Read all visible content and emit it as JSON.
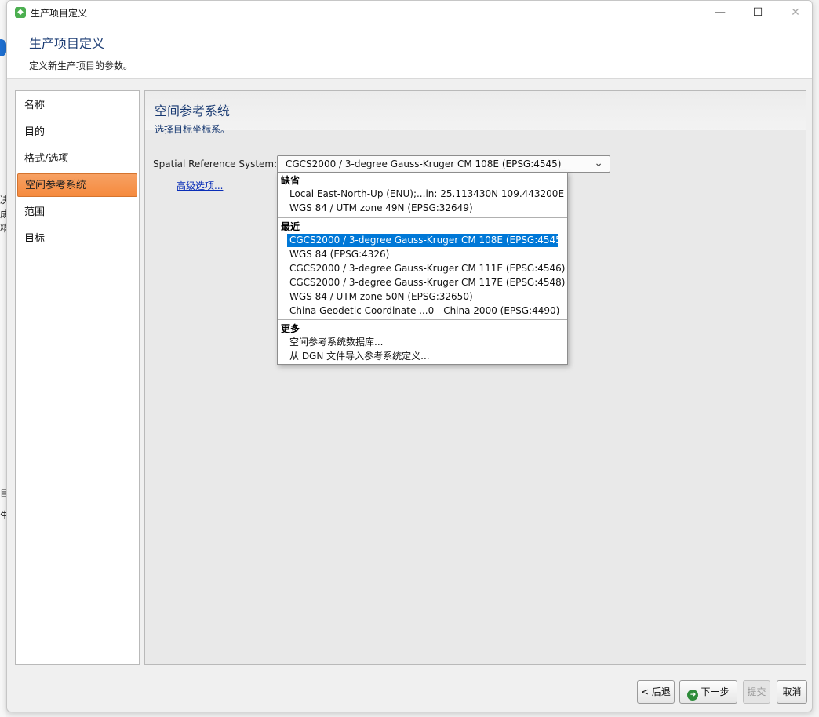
{
  "window": {
    "title": "生产项目定义",
    "header_title": "生产项目定义",
    "header_subtitle": "定义新生产项目的参数。"
  },
  "background_window": {
    "fragments": [
      "合",
      "决",
      "成",
      "精",
      "目",
      "生"
    ]
  },
  "nav": {
    "items": [
      {
        "label": "名称"
      },
      {
        "label": "目的"
      },
      {
        "label": "格式/选项"
      },
      {
        "label": "空间参考系统",
        "active": true
      },
      {
        "label": "范围"
      },
      {
        "label": "目标"
      }
    ]
  },
  "content": {
    "title": "空间参考系统",
    "subtitle": "选择目标坐标系。",
    "srs_label": "Spatial Reference System:",
    "combo_value": "CGCS2000 / 3-degree Gauss-Kruger CM 108E (EPSG:4545)",
    "advanced_link": "高级选项..."
  },
  "dropdown": {
    "groups": [
      {
        "label": "缺省",
        "items": [
          "Local East-North-Up (ENU);...in: 25.113430N 109.443200E",
          "WGS 84 / UTM zone 49N (EPSG:32649)"
        ]
      },
      {
        "label": "最近",
        "items": [
          "CGCS2000 / 3-degree Gauss-Kruger CM 108E (EPSG:4545)",
          "WGS 84 (EPSG:4326)",
          "CGCS2000 / 3-degree Gauss-Kruger CM 111E (EPSG:4546)",
          "CGCS2000 / 3-degree Gauss-Kruger CM 117E (EPSG:4548)",
          "WGS 84 / UTM zone 50N (EPSG:32650)",
          "China Geodetic Coordinate ...0 - China 2000 (EPSG:4490)"
        ]
      },
      {
        "label": "更多",
        "items": [
          "空间参考系统数据库...",
          "从 DGN 文件导入参考系统定义..."
        ]
      }
    ],
    "selected_item": "CGCS2000 / 3-degree Gauss-Kruger CM 108E (EPSG:4545)"
  },
  "footer": {
    "back_label": "< 后退",
    "next_label": "下一步",
    "submit_label": "提交",
    "cancel_label": "取消"
  },
  "colors": {
    "accent_orange": "#f58a3e",
    "selection_blue": "#0078d7",
    "heading_blue": "#1a3b73",
    "link_blue": "#0a2eb8"
  }
}
